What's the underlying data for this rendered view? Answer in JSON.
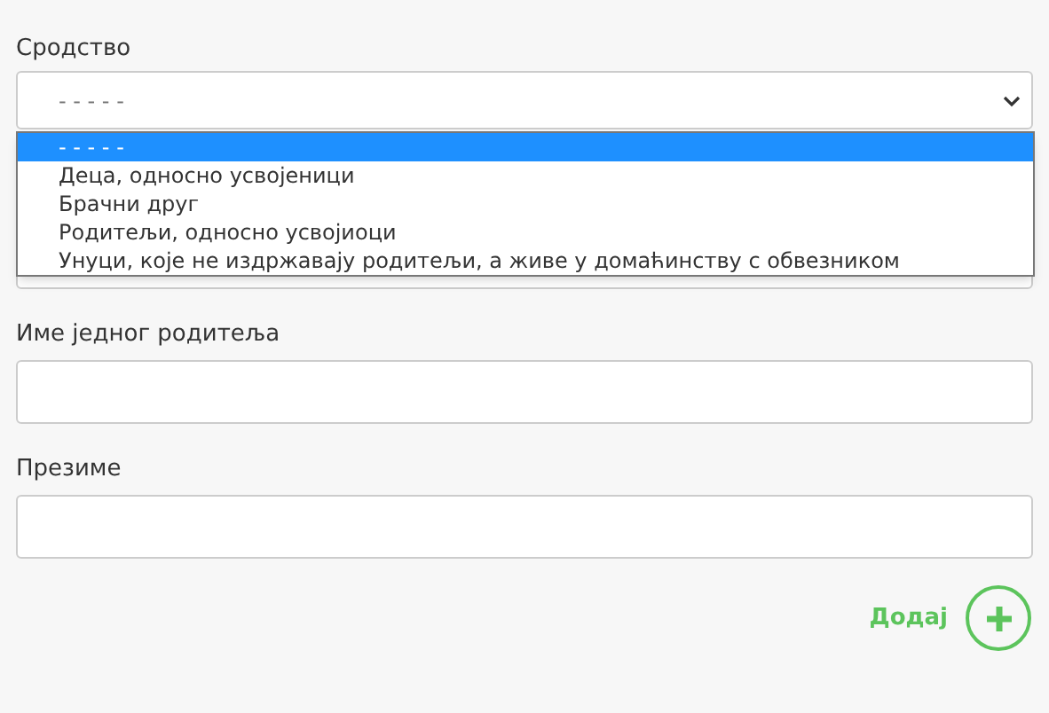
{
  "relation": {
    "label": "Сродство",
    "value": "- - - - -",
    "options": [
      {
        "label": "- - - - -",
        "selected": true
      },
      {
        "label": "Деца, односно усвојеници",
        "selected": false
      },
      {
        "label": "Брачни друг",
        "selected": false
      },
      {
        "label": "Родитељи, односно усвојиоци",
        "selected": false
      },
      {
        "label": "Унуци, које не издржавају родитељи, а живе у домаћинству с обвезником",
        "selected": false
      }
    ]
  },
  "fields": [
    {
      "label": "Име једног родитеља"
    },
    {
      "label": "Презиме"
    }
  ],
  "add_button": {
    "label": "Додај"
  }
}
